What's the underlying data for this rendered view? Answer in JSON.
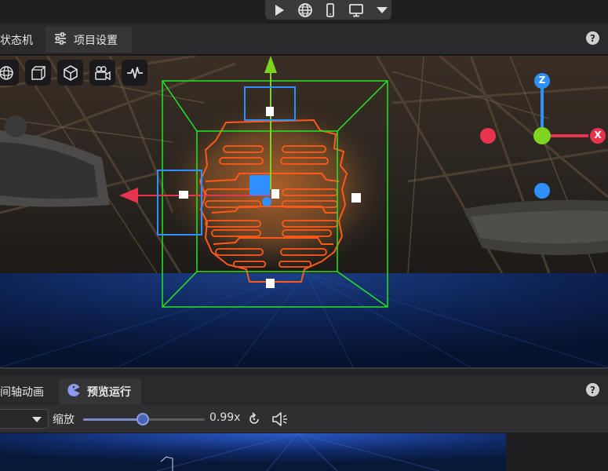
{
  "toolbar": {
    "buttons": [
      "play-icon",
      "globe-icon",
      "phone-icon",
      "monitor-icon",
      "caret-down-icon"
    ]
  },
  "editor_tabs": {
    "items": [
      {
        "label": "状态机",
        "icon": "state-machine-icon",
        "active": false
      },
      {
        "label": "项目设置",
        "icon": "sliders-icon",
        "active": true
      }
    ],
    "help_label": "?"
  },
  "viewport": {
    "tools": [
      "orbit-view-icon",
      "frame-icon",
      "cube-icon",
      "camera-icon",
      "waveform-icon"
    ],
    "gizmo_axes": {
      "z": "Z",
      "x": "X"
    },
    "colors": {
      "selection": "#22e622",
      "outline": "#ff5a1a",
      "axis_x": "#e8334f",
      "axis_y": "#7fd321",
      "axis_z": "#2f8fff",
      "handle": "#2f8fff"
    }
  },
  "bottom_tabs": {
    "items": [
      {
        "label": "间轴动画",
        "active": false
      },
      {
        "label": "预览运行",
        "icon": "pacman-icon",
        "active": true
      }
    ],
    "help_label": "?"
  },
  "preview_controls": {
    "zoom_label": "缩放",
    "zoom_value": "0.99x",
    "zoom_fraction": 0.49,
    "reset_icon": "reset-icon",
    "audio_icon": "speaker-icon"
  }
}
